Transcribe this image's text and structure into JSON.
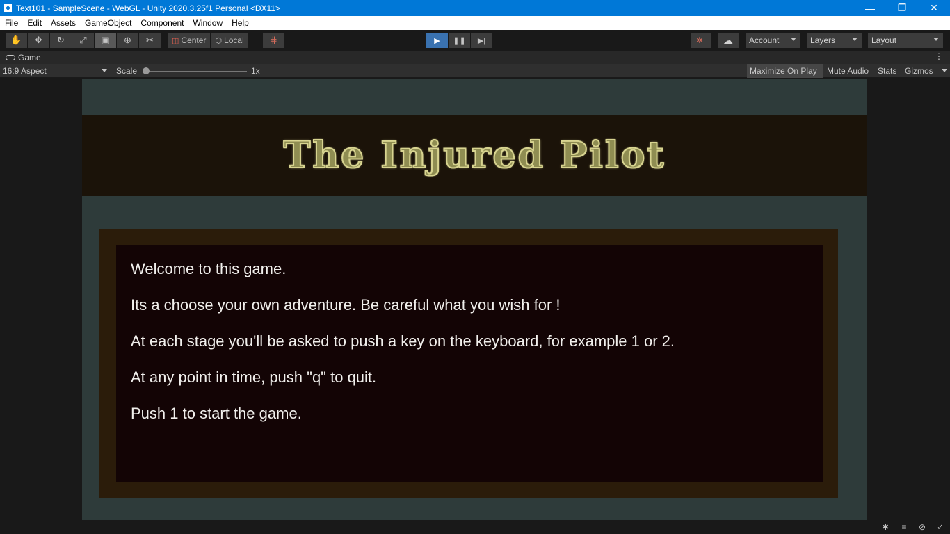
{
  "window": {
    "title": "Text101 - SampleScene - WebGL - Unity 2020.3.25f1 Personal <DX11>",
    "controls": {
      "minimize": "—",
      "restore": "❐",
      "close": "✕"
    }
  },
  "menu": [
    "File",
    "Edit",
    "Assets",
    "GameObject",
    "Component",
    "Window",
    "Help"
  ],
  "toolbar": {
    "tools": [
      {
        "name": "hand-tool",
        "glyph": "✋"
      },
      {
        "name": "move-tool",
        "glyph": "✥"
      },
      {
        "name": "rotate-tool",
        "glyph": "↻"
      },
      {
        "name": "scale-tool",
        "glyph": "⤢"
      },
      {
        "name": "rect-tool",
        "glyph": "▣"
      },
      {
        "name": "transform-tool",
        "glyph": "⊕"
      },
      {
        "name": "custom-tool",
        "glyph": "✂"
      }
    ],
    "pivot_label": "Center",
    "rotation_label": "Local",
    "snap_glyph": "⋕",
    "play_glyph": "▶",
    "pause_glyph": "❚❚",
    "step_glyph": "▶|",
    "collab_glyph": "☁",
    "services_glyph": "✲",
    "account_label": "Account",
    "layers_label": "Layers",
    "layout_label": "Layout"
  },
  "game_tab": {
    "label": "Game",
    "more": "⋮",
    "aspect": "16:9 Aspect",
    "scale_label": "Scale",
    "scale_value": "1x",
    "scale_level": 0.0,
    "maximize_on_play": "Maximize On Play",
    "mute_audio": "Mute Audio",
    "stats": "Stats",
    "gizmos": "Gizmos"
  },
  "game": {
    "title": "The Injured Pilot",
    "story_lines": [
      "Welcome to this game.",
      "Its a choose your own adventure. Be careful what you wish for !",
      "At each stage you'll be asked to push a key on the keyboard, for example 1 or 2.",
      "At any point in time, push \"q\" to quit.",
      "Push 1 to start the game."
    ]
  },
  "status_icons": [
    "bug-icon",
    "cache-server-icon",
    "auto-generate-lighting-icon",
    "progress-icon"
  ],
  "colors": {
    "titlebar": "#0078d7",
    "play_active": "#3a72b0",
    "canvas_bg": "#2e3b3a",
    "banner_bg": "#1b1309",
    "frame_bg": "#2b1c0a",
    "textbox_bg": "#130405",
    "title_text": "#8f8d52"
  }
}
